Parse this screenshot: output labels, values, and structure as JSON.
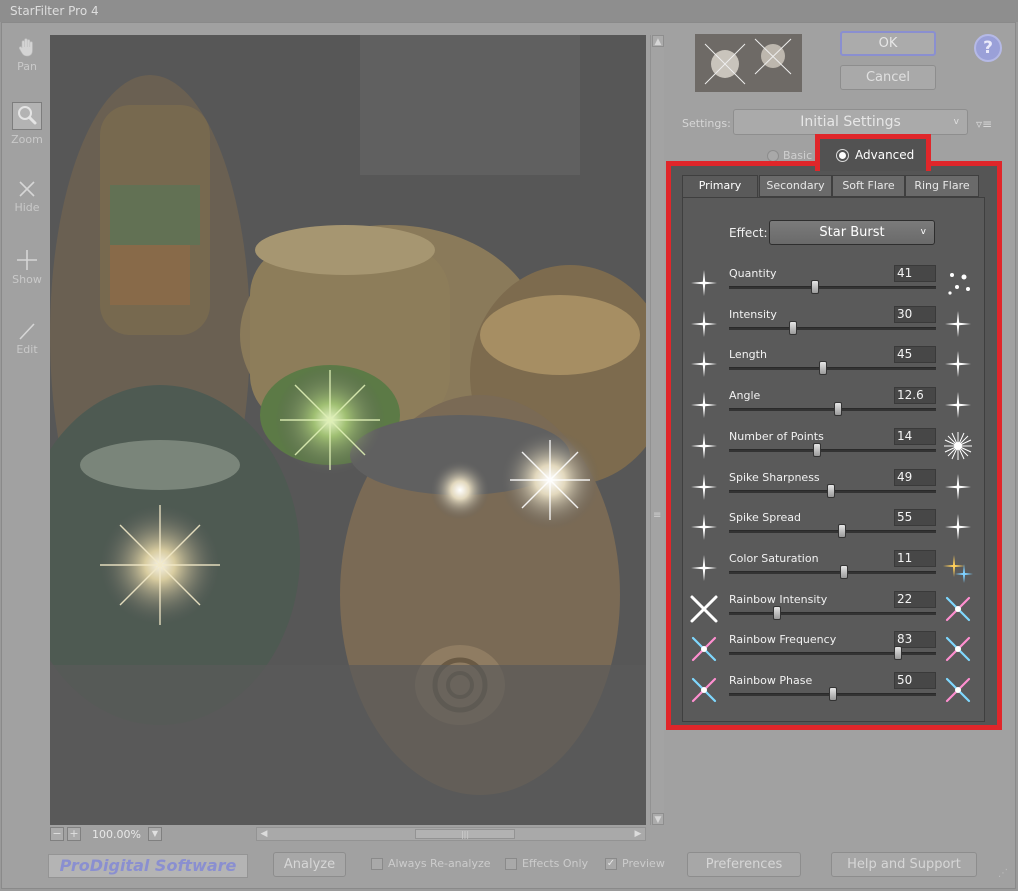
{
  "window": {
    "title": "StarFilter Pro 4"
  },
  "tools": [
    {
      "label": "Pan",
      "icon": "hand-icon"
    },
    {
      "label": "Zoom",
      "icon": "magnifier-icon"
    },
    {
      "label": "Hide",
      "icon": "x-cross-icon"
    },
    {
      "label": "Show",
      "icon": "plus-cross-icon"
    },
    {
      "label": "Edit",
      "icon": "pen-line-icon"
    }
  ],
  "canvas": {
    "zoom": "100.00%"
  },
  "buttons": {
    "ok": "OK",
    "cancel": "Cancel",
    "help": "?"
  },
  "settings": {
    "label": "Settings:",
    "value": "Initial Settings"
  },
  "mode": {
    "basic": "Basic",
    "advanced": "Advanced",
    "selected": "Advanced"
  },
  "tabs": [
    "Primary",
    "Secondary",
    "Soft Flare",
    "Ring Flare"
  ],
  "effect": {
    "label": "Effect:",
    "value": "Star Burst"
  },
  "sliders": [
    {
      "label": "Quantity",
      "value": "41",
      "fraction": 0.41
    },
    {
      "label": "Intensity",
      "value": "30",
      "fraction": 0.3
    },
    {
      "label": "Length",
      "value": "45",
      "fraction": 0.45
    },
    {
      "label": "Angle",
      "value": "12.6",
      "fraction": 0.53
    },
    {
      "label": "Number of Points",
      "value": "14",
      "fraction": 0.42
    },
    {
      "label": "Spike Sharpness",
      "value": "49",
      "fraction": 0.49
    },
    {
      "label": "Spike Spread",
      "value": "55",
      "fraction": 0.55
    },
    {
      "label": "Color Saturation",
      "value": "11",
      "fraction": 0.56
    },
    {
      "label": "Rainbow Intensity",
      "value": "22",
      "fraction": 0.22
    },
    {
      "label": "Rainbow Frequency",
      "value": "83",
      "fraction": 0.83
    },
    {
      "label": "Rainbow Phase",
      "value": "50",
      "fraction": 0.5
    }
  ],
  "bottom": {
    "logo": "ProDigital Software",
    "analyze": "Analyze",
    "always_reanalyze": "Always Re-analyze",
    "effects_only": "Effects Only",
    "preview": "Preview",
    "preferences": "Preferences",
    "help_support": "Help and Support"
  },
  "colors": {
    "highlight": "#e0262a",
    "panel": "#555555",
    "accent": "#8a8fd0"
  }
}
